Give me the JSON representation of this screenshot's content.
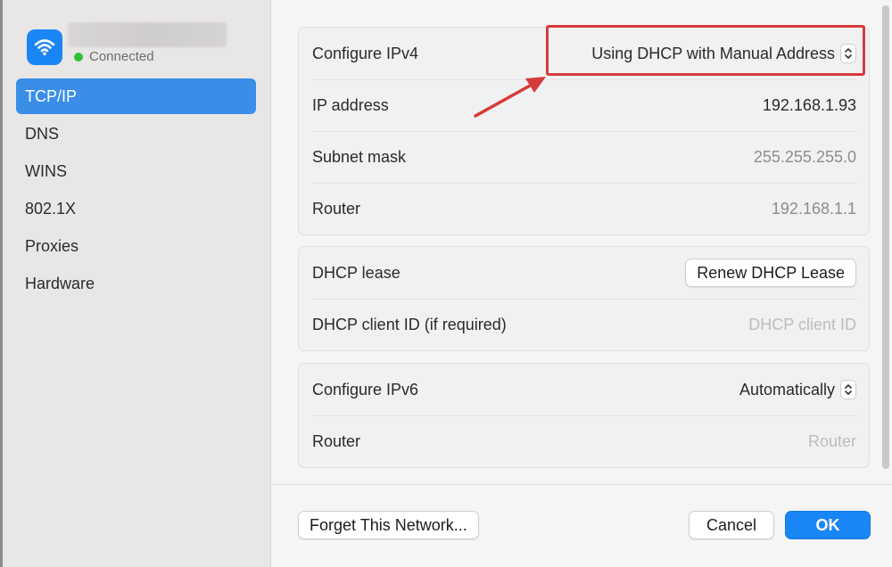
{
  "network": {
    "status": "Connected"
  },
  "sidebar": {
    "items": [
      {
        "label": "TCP/IP",
        "selected": true
      },
      {
        "label": "DNS"
      },
      {
        "label": "WINS"
      },
      {
        "label": "802.1X"
      },
      {
        "label": "Proxies"
      },
      {
        "label": "Hardware"
      }
    ]
  },
  "ipv4": {
    "configure_label": "Configure IPv4",
    "configure_value": "Using DHCP with Manual Address",
    "ip_label": "IP address",
    "ip_value": "192.168.1.93",
    "subnet_label": "Subnet mask",
    "subnet_value": "255.255.255.0",
    "router_label": "Router",
    "router_value": "192.168.1.1"
  },
  "dhcp": {
    "lease_label": "DHCP lease",
    "renew_button": "Renew DHCP Lease",
    "client_id_label": "DHCP client ID (if required)",
    "client_id_placeholder": "DHCP client ID"
  },
  "ipv6": {
    "configure_label": "Configure IPv6",
    "configure_value": "Automatically",
    "router_label": "Router",
    "router_placeholder": "Router"
  },
  "footer": {
    "forget_button": "Forget This Network...",
    "cancel_button": "Cancel",
    "ok_button": "OK"
  },
  "colors": {
    "accent": "#1a86f5",
    "sidebar_selected": "#3a8ee8",
    "annotation": "#d63b3b",
    "connected": "#2ec23a"
  },
  "icons": {
    "network": "wifi-icon",
    "popup": "chevron-up-down-icon"
  }
}
